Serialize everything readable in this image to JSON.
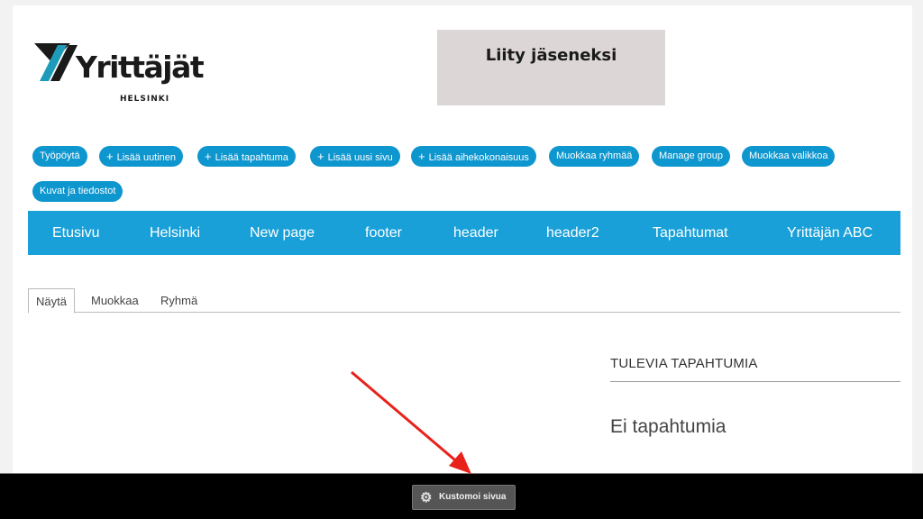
{
  "brand": {
    "name": "Yrittäjät",
    "subtitle": "HELSINKI",
    "colors": {
      "teal": "#1e9bb8",
      "dark": "#1a1a1a"
    }
  },
  "join": {
    "label": "Liity jäseneksi"
  },
  "admin_buttons": [
    {
      "label": "Työpöytä",
      "plus": ""
    },
    {
      "label": "Lisää uutinen",
      "plus": "+"
    },
    {
      "label": "Lisää tapahtuma",
      "plus": "+"
    },
    {
      "label": "Lisää uusi sivu",
      "plus": "+"
    },
    {
      "label": "Lisää aihekokonaisuus",
      "plus": "+"
    },
    {
      "label": "Muokkaa ryhmää",
      "plus": ""
    },
    {
      "label": "Manage group",
      "plus": ""
    },
    {
      "label": "Muokkaa valikkoa",
      "plus": ""
    },
    {
      "label": "Kuvat ja tiedostot",
      "plus": ""
    }
  ],
  "main_nav": [
    "Etusivu",
    "Helsinki",
    "New page",
    "footer",
    "header",
    "header2",
    "Tapahtumat",
    "Yrittäjän ABC"
  ],
  "tabs": [
    {
      "label": "Näytä",
      "active": true
    },
    {
      "label": "Muokkaa",
      "active": false
    },
    {
      "label": "Ryhmä",
      "active": false
    }
  ],
  "sidebar": {
    "title": "TULEVIA TAPAHTUMIA",
    "empty_text": "Ei tapahtumia"
  },
  "bottom_bar": {
    "customize_label": "Kustomoi sivua",
    "icon": "gear-icon"
  },
  "colors": {
    "accent": "#0e96cf",
    "nav": "#1aa0d8",
    "annotation": "#e8221b"
  }
}
